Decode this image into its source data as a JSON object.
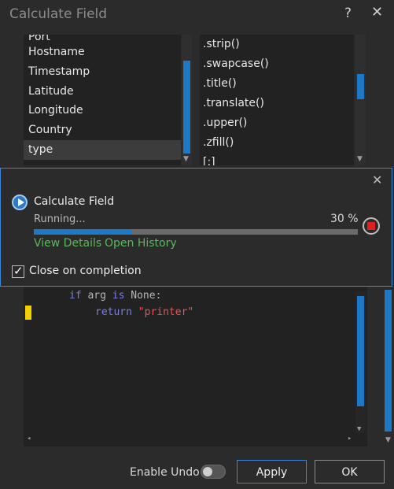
{
  "window": {
    "title": "Calculate Field",
    "help_icon": "?",
    "close_icon": "✕"
  },
  "fields_list": {
    "items": [
      "Port",
      "Hostname",
      "Timestamp",
      "Latitude",
      "Longitude",
      "Country",
      "type"
    ],
    "selected": "type"
  },
  "functions_list": {
    "items": [
      ".strip()",
      ".swapcase()",
      ".title()",
      ".translate()",
      ".upper()",
      ".zfill()",
      "[:]"
    ]
  },
  "progress": {
    "close_icon": "✕",
    "title": "Calculate Field",
    "status": "Running...",
    "percent_text": "30 %",
    "percent_value": 0.3,
    "view_details": "View Details",
    "open_history": "Open History",
    "close_on_completion_label": "Close on completion",
    "close_on_completion_checked": true
  },
  "code_block": {
    "line1": {
      "kw1": "if",
      "text1": " arg ",
      "kw2": "is",
      "text2": " None:"
    },
    "line2": {
      "kw": "return",
      "str": "\"printer\""
    }
  },
  "footer": {
    "enable_undo_label": "Enable Undo",
    "enable_undo_on": false,
    "apply_label": "Apply",
    "ok_label": "OK"
  },
  "colors": {
    "accent": "#1e78c8",
    "link": "#5cb85c",
    "stop": "#e02020",
    "keyword": "#7d7dd9",
    "string": "#e05555"
  }
}
